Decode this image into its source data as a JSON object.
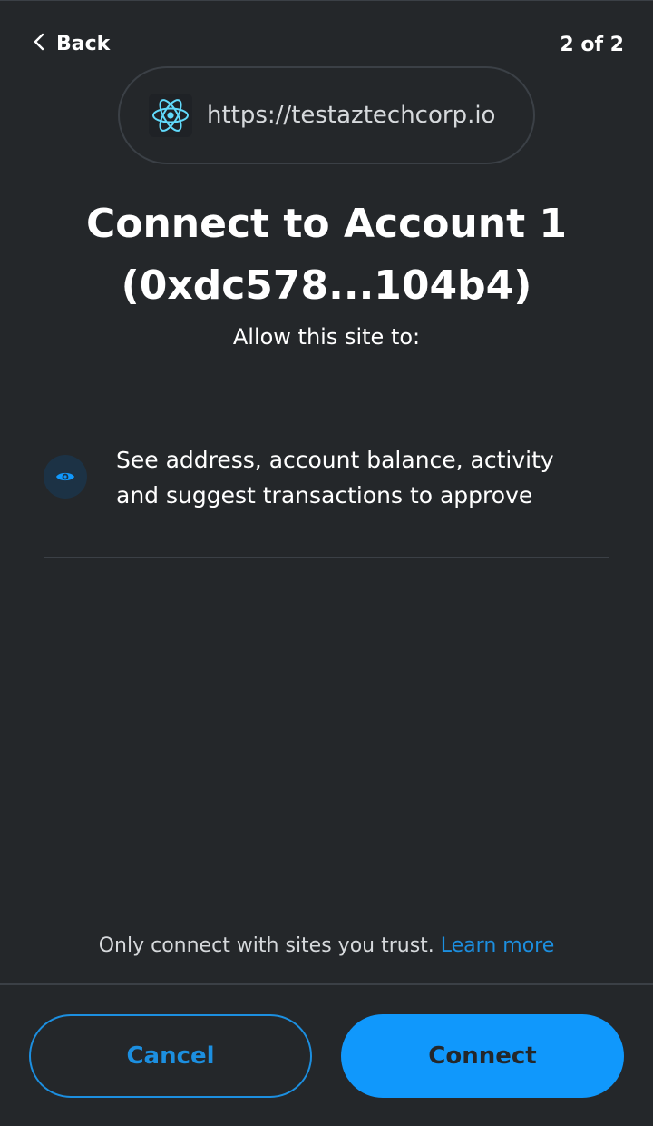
{
  "header": {
    "back_label": "Back",
    "step": "2 of 2"
  },
  "origin": {
    "icon": "react-atom-icon",
    "url": "https://testaztechcorp.io"
  },
  "title": {
    "line1": "Connect to Account 1",
    "line2": "(0xdc578...104b4)"
  },
  "subtitle": "Allow this site to:",
  "permissions": [
    {
      "icon": "eye-icon",
      "text_line1": "See address, account balance, activity",
      "text_line2": "and suggest transactions to approve"
    }
  ],
  "trust": {
    "text": "Only connect with sites you trust.",
    "link": "Learn more"
  },
  "buttons": {
    "cancel": "Cancel",
    "connect": "Connect"
  },
  "colors": {
    "background": "#24272a",
    "accent": "#1098fc",
    "link": "#1c8fe0"
  }
}
